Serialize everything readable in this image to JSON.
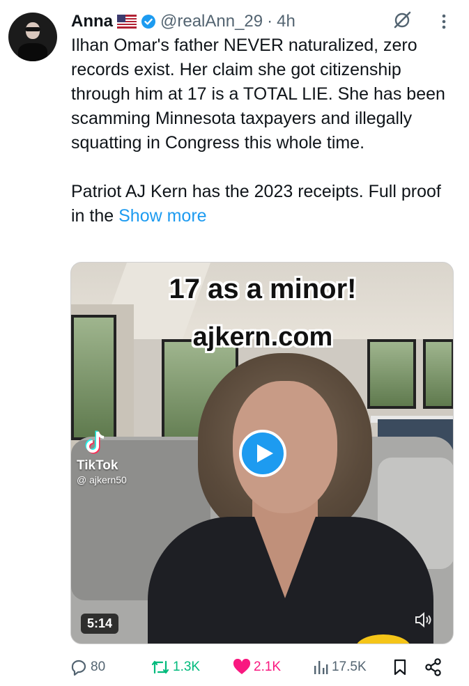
{
  "author": {
    "name": "Anna",
    "flag": "us-flag-icon",
    "verified": "verified-badge-icon",
    "handle": "@realAnn_29",
    "separator": "·",
    "time": "4h"
  },
  "tweet": {
    "paragraph1": "Ilhan Omar's father NEVER naturalized, zero records exist. Her claim she got citizenship through him at 17 is a TOTAL LIE. She has been scamming Minnesota taxpayers and illegally squatting in Congress this whole time.",
    "paragraph2": "Patriot AJ Kern has the 2023 receipts. Full proof in the",
    "show_more": "Show more"
  },
  "media": {
    "overlay_line1": "17 as a minor!",
    "overlay_line2": "ajkern.com",
    "watermark_name": "TikTok",
    "watermark_handle": "@ ajkern50",
    "duration": "5:14"
  },
  "actions": {
    "replies": "80",
    "reposts": "1.3K",
    "likes": "2.1K",
    "views": "17.5K"
  },
  "colors": {
    "accent": "#1d9bf0",
    "repost": "#00ba7c",
    "like": "#f91880",
    "muted": "#536471"
  }
}
